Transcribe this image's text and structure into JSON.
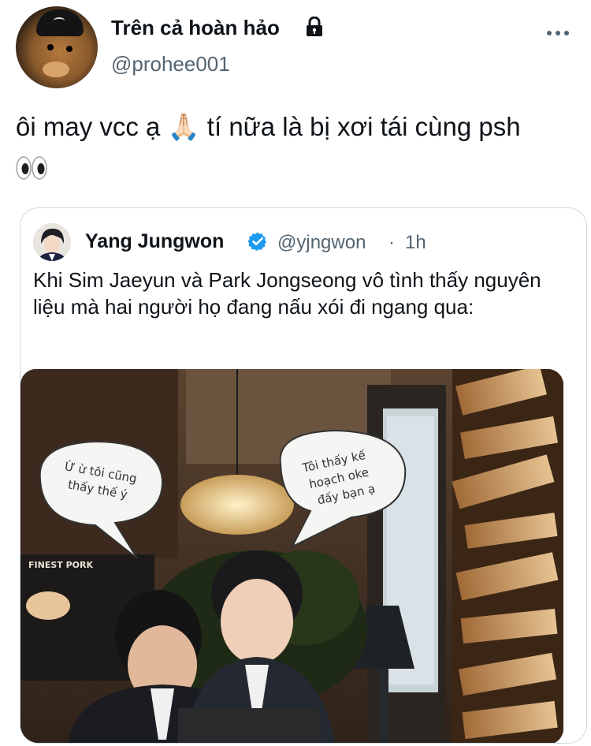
{
  "tweet": {
    "display_name": "Trên cả hoàn hảo",
    "handle": "@prohee001",
    "text_line1": "ôi may vcc ạ 🙏🏻 tí nữa là bị xơi tái cùng psh",
    "icons": {
      "lock": "lock-icon",
      "more": "more-icon",
      "emoji": "eyes-emoji"
    }
  },
  "quote": {
    "name": "Yang Jungwon",
    "handle": "@yjngwon",
    "separator": "·",
    "time": "1h",
    "text": "Khi Sim Jaeyun và Park Jongseong vô tình thấy nguyên liệu mà hai người họ đang nấu xói đi ngang qua:",
    "verified_icon": "verified-badge-icon",
    "media": {
      "bubble_left": [
        "Ừ ừ tôi cũng",
        "thấy thế ý"
      ],
      "bubble_right": [
        "Tôi thấy kế",
        "hoạch oke",
        "đấy bạn ạ"
      ],
      "sign": "FINEST PORK"
    }
  },
  "colors": {
    "text": "#0f1419",
    "secondary": "#536471",
    "verified": "#1d9bf0",
    "border": "#cfd9de"
  }
}
